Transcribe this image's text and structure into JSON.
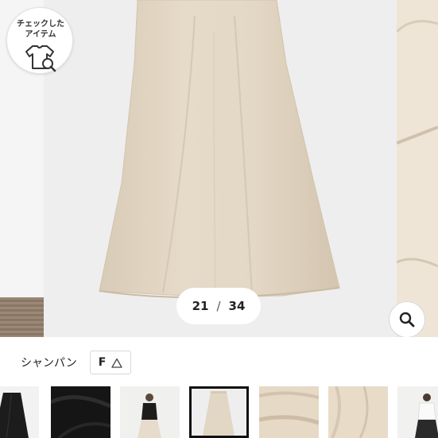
{
  "checked_items": {
    "label": "チェックした\nアイテム",
    "icon": "tshirt-search-icon"
  },
  "gallery": {
    "current": "21",
    "separator": "/",
    "total": "34",
    "zoom_icon": "magnifier-icon"
  },
  "variant": {
    "color_name": "シャンパン",
    "size": "F",
    "stock_icon": "triangle-icon"
  },
  "thumbnails": {
    "count": 8,
    "selected_index": 3
  },
  "colors": {
    "skirt": "#e2d6c4",
    "selected_border": "#111111",
    "text": "#222222"
  }
}
